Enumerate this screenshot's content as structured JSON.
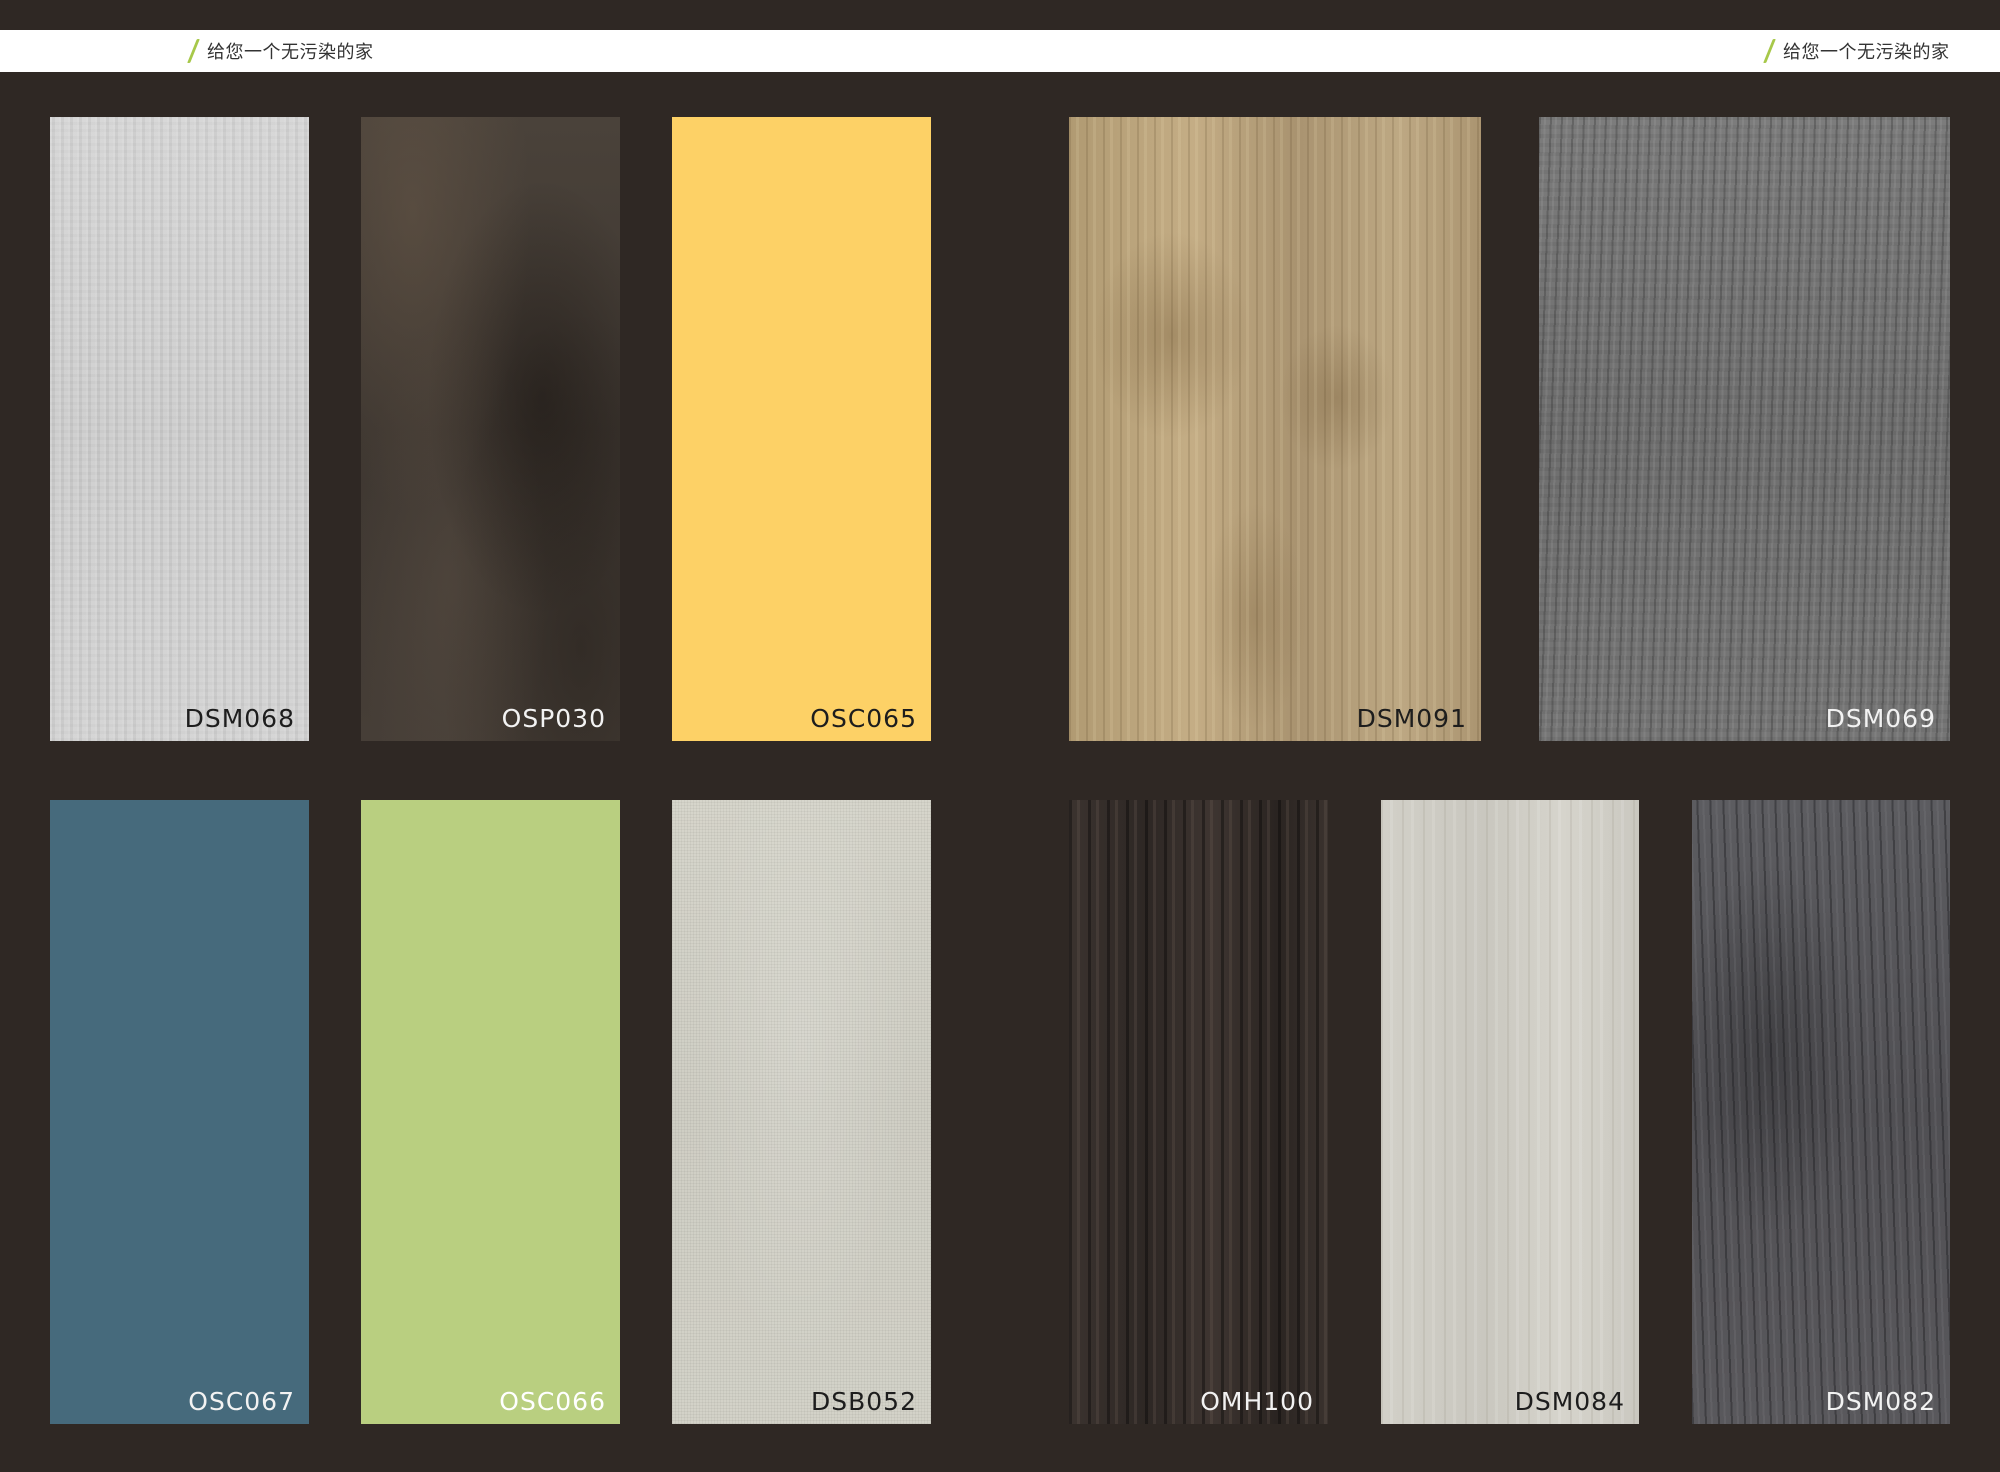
{
  "header": {
    "tagline_left": "给您一个无污染的家",
    "tagline_right": "给您一个无污染的家",
    "accent_color": "#a7c84a"
  },
  "swatches": [
    {
      "code": "DSM068",
      "color": "#cfcfcf"
    },
    {
      "code": "OSP030",
      "color": "#433b35"
    },
    {
      "code": "OSC065",
      "color": "#fdd166"
    },
    {
      "code": "DSM091",
      "color": "#b5a07a"
    },
    {
      "code": "DSM069",
      "color": "#757575"
    },
    {
      "code": "OSC067",
      "color": "#466a7c"
    },
    {
      "code": "OSC066",
      "color": "#b9cf80"
    },
    {
      "code": "DSB052",
      "color": "#d2d1c7"
    },
    {
      "code": "OMH100",
      "color": "#342d29"
    },
    {
      "code": "DSM084",
      "color": "#cfcdc5"
    },
    {
      "code": "DSM082",
      "color": "#555458"
    }
  ]
}
